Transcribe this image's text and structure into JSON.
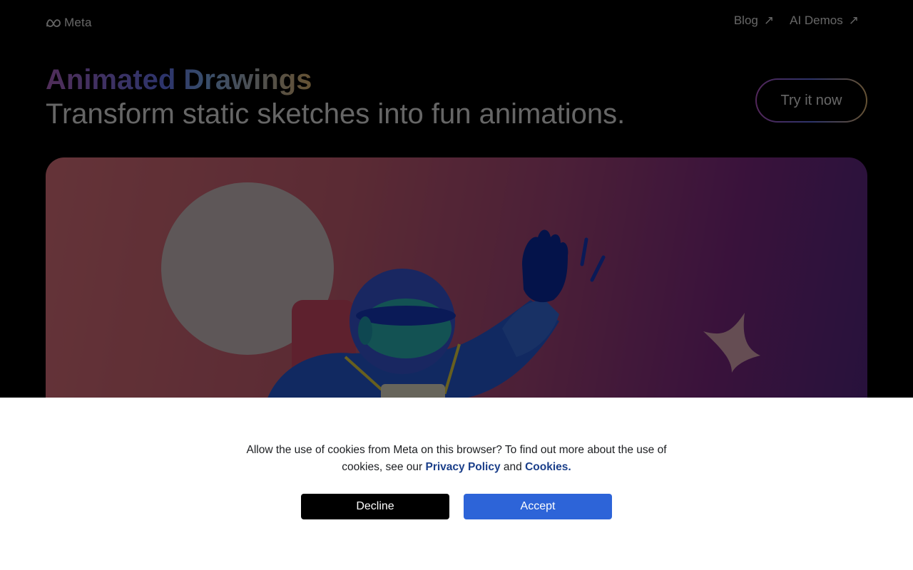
{
  "brand": {
    "logo_text": "Meta"
  },
  "nav": [
    {
      "label": "Blog",
      "icon": "external-arrow-icon"
    },
    {
      "label": "AI Demos",
      "icon": "external-arrow-icon"
    }
  ],
  "hero": {
    "title": "Animated Drawings",
    "subtitle": "Transform static sketches into fun animations.",
    "cta_label": "Try it now"
  },
  "cookie_banner": {
    "text_before": "Allow the use of cookies from Meta on this browser? To find out more about the use of cookies, see our ",
    "privacy_link": "Privacy Policy",
    "and_text": " and ",
    "cookies_link": "Cookies.",
    "decline_label": "Decline",
    "accept_label": "Accept"
  },
  "colors": {
    "accept_button": "#2d64d8",
    "decline_button": "#000000",
    "link": "#1b3f8a"
  }
}
